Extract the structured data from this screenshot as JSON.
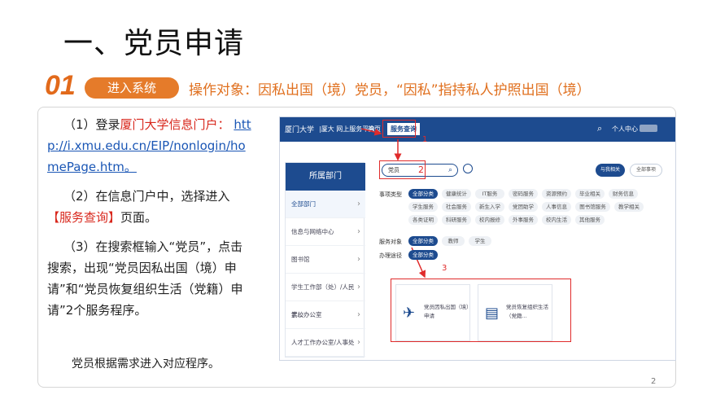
{
  "slide": {
    "title": "一、党员申请",
    "step_number": "01",
    "step_label": "进入系统",
    "subject_line": "操作对象：因私出国（境）党员，“因私”指持私人护照出国（境）",
    "page_number": "2"
  },
  "instructions": {
    "p1_prefix": "（1）登录",
    "p1_portal": "厦门大学信息门户：",
    "p1_url": "http://i.xmu.edu.cn/EIP/nonlogin/homePage.htm。",
    "p2_prefix": "（2）在信息门户中，选择进入",
    "p2_highlight": "【服务查询】",
    "p2_suffix": "页面。",
    "p3": "（3）在搜索框输入“党员”，点击搜索，出现“党员因私出国（境）申请”和“党员恢复组织生活（党籍）申请”2个服务程序。",
    "note": "党员根据需求进入对应程序。"
  },
  "screenshot": {
    "logo_text": "厦门大学",
    "platform": "|厦大 网上服务平台",
    "nav_home": "首页",
    "nav_service": "服务查询",
    "user_center": "个人中心",
    "search_value": "党员",
    "btn_related": "与我相关",
    "btn_all": "全部事项",
    "sidebar_title": "所属部门",
    "sidebar_items": [
      "全部部门",
      "信息与网络中心",
      "图书馆",
      "学生工作部（处）/人民武...",
      "学校办公室",
      "人才工作办公室/人事处"
    ],
    "row_labels": {
      "type": "事项类型",
      "target": "服务对象",
      "channel": "办理途径"
    },
    "type_chips": [
      "全部分类",
      "健康统计",
      "IT服务",
      "密码服务",
      "资源预约",
      "毕业相关",
      "财务信息",
      "学生服务",
      "社会服务",
      "新生入学",
      "党团助学",
      "人事信息",
      "图书馆服务",
      "教学相关",
      "各类证明",
      "科研服务",
      "校内报修",
      "外事服务",
      "校内生活",
      "其他服务"
    ],
    "target_chips": [
      "全部分类",
      "教师",
      "学生"
    ],
    "channel_chips": [
      "全部分类"
    ],
    "cards": [
      {
        "title": "党员因私出国（境）申请"
      },
      {
        "title": "党员恢复组织生活（党籍..."
      }
    ],
    "markers": [
      "1",
      "2",
      "3"
    ],
    "accent_color": "#1d4b8f",
    "marker_color": "#e02b2b"
  }
}
